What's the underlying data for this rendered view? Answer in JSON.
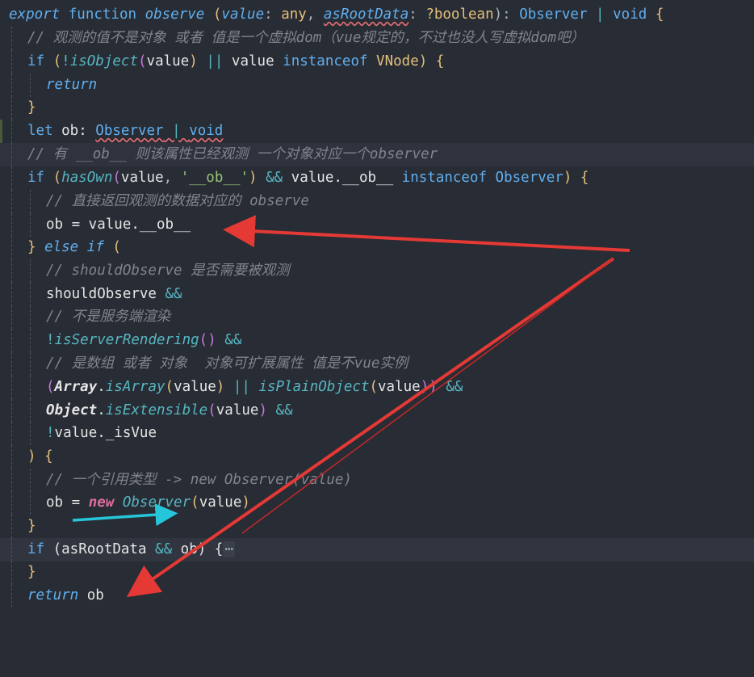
{
  "editor": {
    "language": "javascript",
    "theme_colors": {
      "background": "#282c34",
      "keyword": "#c678dd",
      "function": "#61afef",
      "comment": "#7f848e",
      "string": "#98c379",
      "annotation_arrow_red": "#e53935",
      "annotation_arrow_cyan": "#26c6da"
    },
    "lines": {
      "l1": {
        "a": "export",
        "b": " function ",
        "c": "observe",
        "d": " (",
        "e": "value",
        "f": ": ",
        "g": "any",
        "h": ", ",
        "i": "asRootData",
        "j": ": ",
        "k": "?boolean",
        "l": "): ",
        "m": "Observer",
        "n": " | ",
        "o": "void",
        "p": " {"
      },
      "l2": {
        "a": "// 观测的值不是对象 或者 值是一个虚拟dom（vue规定的，不过也没人写虚拟dom吧）"
      },
      "l3": {
        "a": "if",
        "b": " (",
        "c": "!",
        "d": "isObject",
        "e": "(",
        "f": "value",
        "g": ") ",
        "h": "||",
        "i": " value ",
        "j": "instanceof",
        "k": " VNode",
        "l": ") {"
      },
      "l4": {
        "a": "return"
      },
      "l5": {
        "a": "}"
      },
      "l6": {
        "a": "let",
        "b": " ob: ",
        "c": "Observer",
        "d": " | ",
        "e": "void"
      },
      "l7": {
        "a": "// 有 __ob__ 则该属性已经观测 一个对象对应一个observer"
      },
      "l8": {
        "a": "if",
        "b": " (",
        "c": "hasOwn",
        "d": "(",
        "e": "value",
        "f": ", ",
        "g": "'__ob__'",
        "h": ") ",
        "i": "&&",
        "j": " value.__ob__ ",
        "k": "instanceof",
        "l": " Observer",
        "m": ") {"
      },
      "l9": {
        "a": "// 直接返回观测的数据对应的 observe"
      },
      "l10": {
        "a": "ob = value.__ob__"
      },
      "l11": {
        "a": "} ",
        "b": "else",
        "c": " ",
        "d": "if",
        "e": " ("
      },
      "l12": {
        "a": "// shouldObserve 是否需要被观测"
      },
      "l13": {
        "a": "shouldObserve ",
        "b": "&&"
      },
      "l14": {
        "a": "// 不是服务端渲染"
      },
      "l15": {
        "a": "!",
        "b": "isServerRendering",
        "c": "()",
        "d": " ",
        "e": "&&"
      },
      "l16": {
        "a": "// 是数组 或者 对象  对象可扩展属性 值是不vue实例"
      },
      "l17": {
        "a": "(",
        "b": "Array",
        "c": ".",
        "d": "isArray",
        "e": "(",
        "f": "value",
        "g": ")",
        "h": " || ",
        "i": "isPlainObject",
        "j": "(",
        "k": "value",
        "l": "))",
        "m": " ",
        "n": "&&"
      },
      "l18": {
        "a": "Object",
        "b": ".",
        "c": "isExtensible",
        "d": "(",
        "e": "value",
        "f": ")",
        "g": " ",
        "h": "&&"
      },
      "l19": {
        "a": "!",
        "b": "value._isVue"
      },
      "l20": {
        "a": ")",
        "b": " {"
      },
      "l21": {
        "a": "// 一个引用类型 -> new Observer(value)"
      },
      "l22": {
        "a": "ob = ",
        "b": "new",
        "c": " ",
        "d": "Observer",
        "e": "(",
        "f": "value",
        "g": ")"
      },
      "l23": {
        "a": "}"
      },
      "l24": {
        "a": "if",
        "b": " (asRootData ",
        "c": "&&",
        "d": " ob) {",
        "e": "⋯"
      },
      "l25": {
        "a": "}"
      },
      "l26": {
        "a": "return",
        "b": " ob"
      }
    }
  }
}
